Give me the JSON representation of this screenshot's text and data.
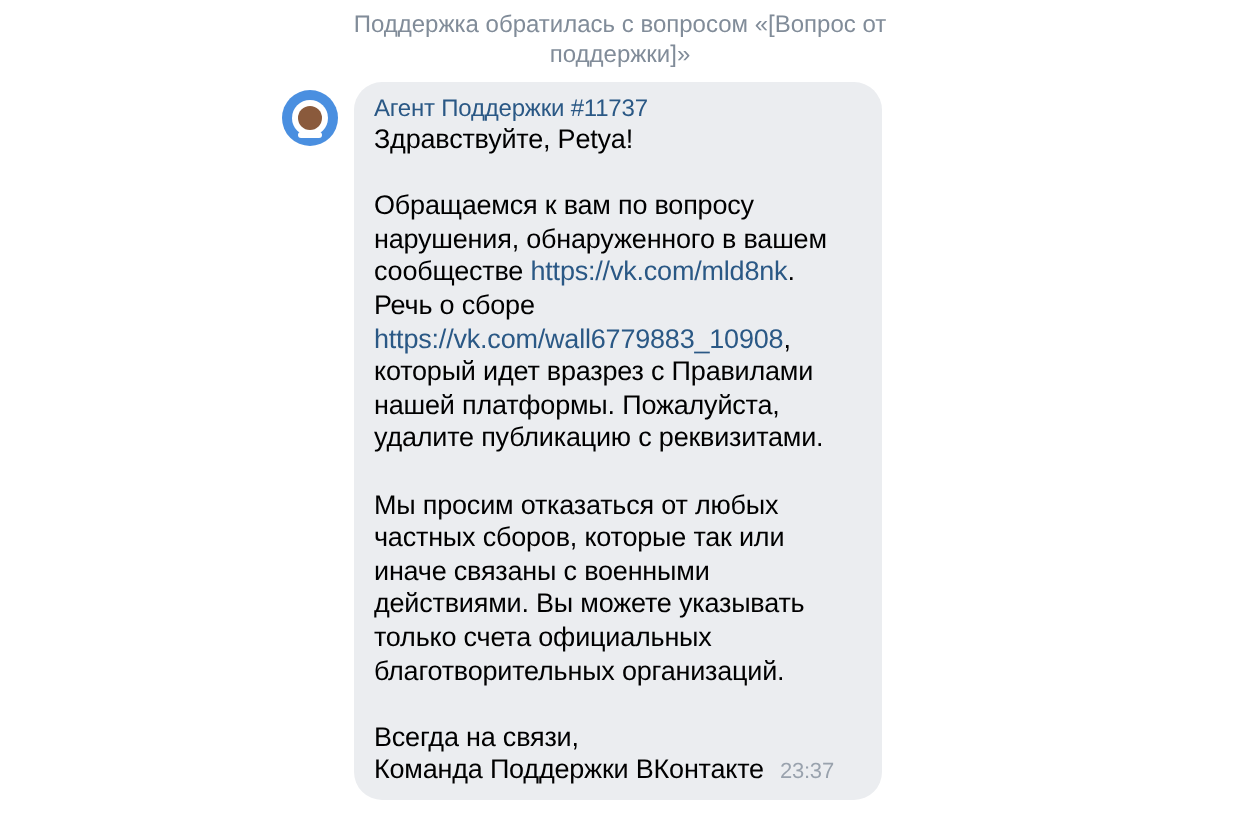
{
  "notice": "Поддержка обратилась с вопросом «[Вопрос от поддержки]»",
  "message": {
    "sender": "Агент Поддержки #11737",
    "time": "23:37",
    "paragraphs": [
      [
        {
          "kind": "text",
          "text": "Здравствуйте, Petya!"
        }
      ],
      [
        {
          "kind": "text",
          "text": "Обращаемся к вам по вопросу нарушения, обнаруженного в вашем сообществе "
        },
        {
          "kind": "link",
          "text": "https://vk.com/mld8nk"
        },
        {
          "kind": "text",
          "text": ".\nРечь о сборе "
        },
        {
          "kind": "link",
          "text": "https://vk.com/wall6779883_10908"
        },
        {
          "kind": "text",
          "text": ", который идет вразрез с Правилами нашей платформы. Пожалуйста, удалите публикацию с реквизитами."
        }
      ],
      [
        {
          "kind": "text",
          "text": "Мы просим отказаться от любых частных сборов, которые так или иначе связаны с военными действиями. Вы можете указывать только счета официальных благотворительных организаций."
        }
      ],
      [
        {
          "kind": "text",
          "text": "Всегда на связи,\nКоманда Поддержки ВКонтакте"
        }
      ]
    ]
  }
}
